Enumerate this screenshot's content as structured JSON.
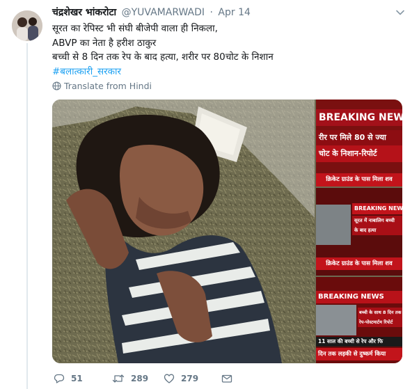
{
  "tweet": {
    "author_name": "चंद्रशेखर भांकरोटा",
    "handle": "@YUVAMARWADI",
    "separator": "·",
    "date": "Apr 14",
    "lines": [
      "सूरत का रेपिस्ट भी संघी बीजेपी वाला ही निकला,",
      "ABVP का नेता है हरीश ठाकुर",
      "बच्ची से 8 दिन तक रेप के बाद हत्या, शरीर पर 80चोट के निशान"
    ],
    "hashtag": "#बलात्कारी_सरकार",
    "translate_label": "Translate from Hindi"
  },
  "media": {
    "panel1": {
      "breaking": "BREAKING NEWS",
      "headline1": "रीर पर मिले 80 से ज्या",
      "headline2": "चोट के निशान-रिपोर्ट",
      "caption": "क्रिकेट ग्राउंड के पास मिला शव"
    },
    "panel2": {
      "breaking": "BREAKING NEWS",
      "subtext1": "सूरत में नाबालिग बच्ची",
      "subtext2": "के बाद हत्या",
      "caption": "क्रिकेट ग्राउंड के पास मिला शव"
    },
    "panel3": {
      "breaking": "BREAKING NEWS",
      "subtext1": "बच्ची के साथ 8 दिन तक",
      "subtext2": "रेप-पोस्टमार्टम रिपोर्ट",
      "band": "11 साल की बच्ची से रेप और फि",
      "caption": "दिन तक लड़की से दुष्कर्म किया"
    }
  },
  "actions": {
    "reply_count": "51",
    "retweet_count": "289",
    "like_count": "279"
  },
  "colors": {
    "link": "#1da1f2",
    "secondary_text": "#657786",
    "hashtag": "#1da1f2",
    "news_red": "#c2141b"
  },
  "icons": [
    "caret-down-icon",
    "globe-icon",
    "reply-icon",
    "retweet-icon",
    "like-icon",
    "message-icon"
  ]
}
